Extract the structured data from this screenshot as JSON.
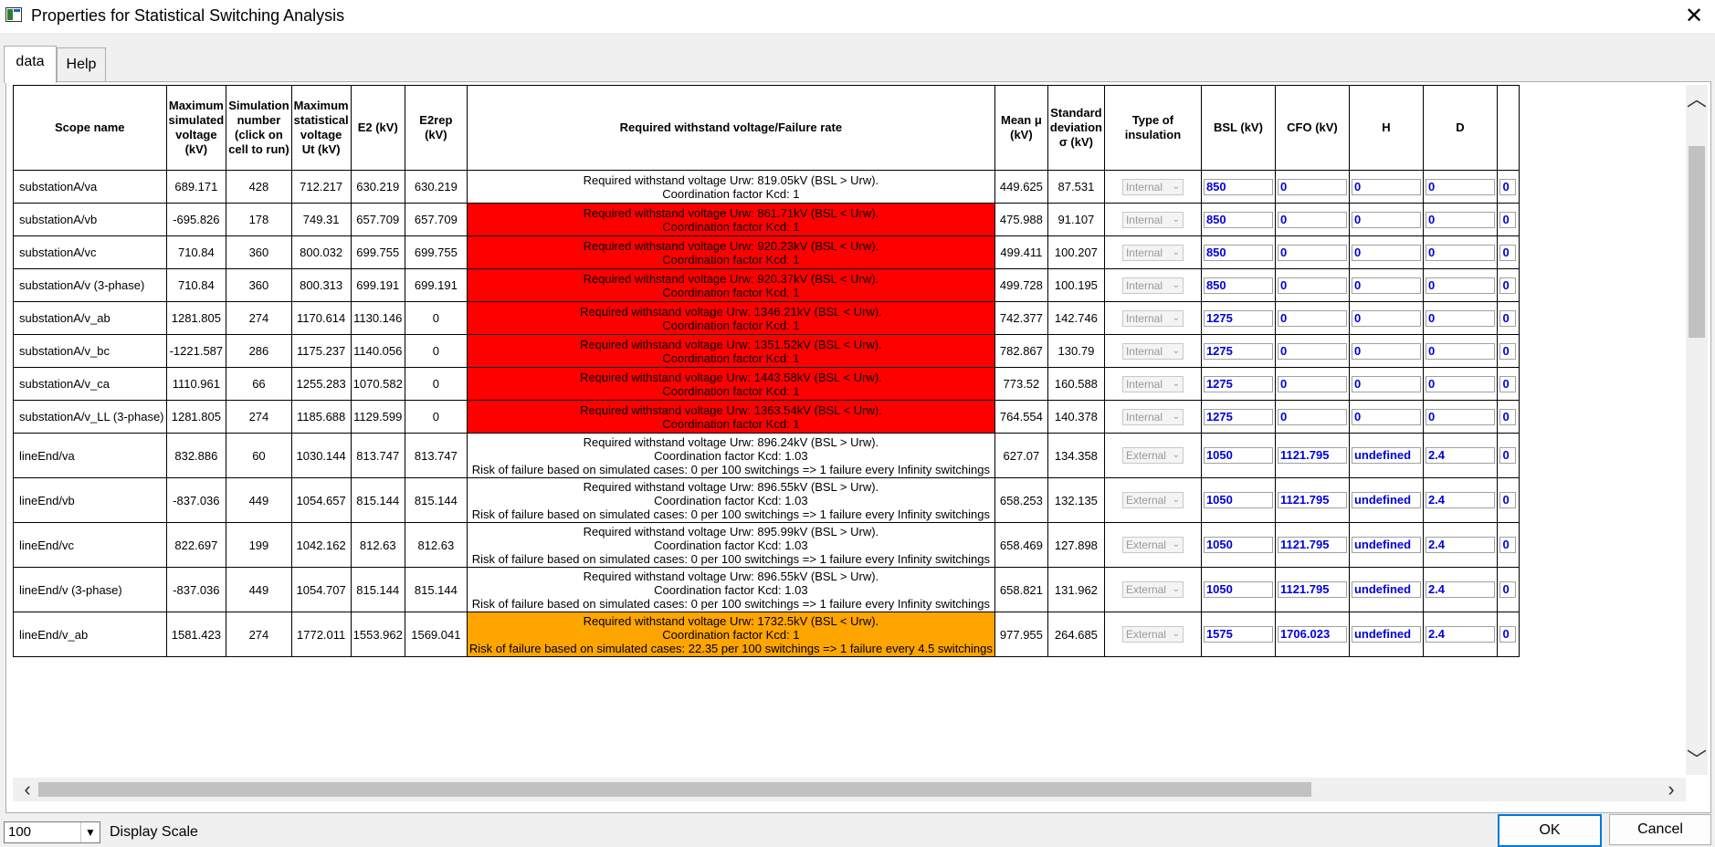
{
  "window": {
    "title": "Properties for Statistical Switching Analysis",
    "close_symbol": "✕"
  },
  "tabs": [
    {
      "label": "data"
    },
    {
      "label": "Help"
    }
  ],
  "grid": {
    "headers": {
      "scope": "Scope name",
      "max_sim": "Maximum simulated voltage (kV)",
      "sim_num": "Simulation number (click on cell to run)",
      "max_stat": "Maximum statistical voltage Ut (kV)",
      "e2": "E2 (kV)",
      "e2rep": "E2rep (kV)",
      "req": "Required withstand voltage/Failure rate",
      "mean": "Mean μ (kV)",
      "std": "Standard deviation σ (kV)",
      "ins": "Type of insulation",
      "bsl": "BSL (kV)",
      "cfo": "CFO (kV)",
      "h": "H",
      "d": "D"
    },
    "rows": [
      {
        "scope": "substationA/va",
        "max_sim": "689.171",
        "sim_num": "428",
        "max_stat": "712.217",
        "e2": "630.219",
        "e2rep": "630.219",
        "req_status": "ok",
        "req_lines": [
          "Required withstand voltage Urw: 819.05kV (BSL > Urw).",
          "Coordination factor Kcd: 1"
        ],
        "mean": "449.625",
        "std": "87.531",
        "ins": "Internal",
        "bsl": "850",
        "cfo": "0",
        "h": "0",
        "d": "0",
        "extra": "0"
      },
      {
        "scope": "substationA/vb",
        "max_sim": "-695.826",
        "sim_num": "178",
        "max_stat": "749.31",
        "e2": "657.709",
        "e2rep": "657.709",
        "req_status": "fail",
        "req_lines": [
          "Required withstand voltage Urw: 861.71kV (BSL < Urw).",
          "Coordination factor Kcd: 1"
        ],
        "mean": "475.988",
        "std": "91.107",
        "ins": "Internal",
        "bsl": "850",
        "cfo": "0",
        "h": "0",
        "d": "0",
        "extra": "0"
      },
      {
        "scope": "substationA/vc",
        "max_sim": "710.84",
        "sim_num": "360",
        "max_stat": "800.032",
        "e2": "699.755",
        "e2rep": "699.755",
        "req_status": "fail",
        "req_lines": [
          "Required withstand voltage Urw: 920.23kV (BSL < Urw).",
          "Coordination factor Kcd: 1"
        ],
        "mean": "499.411",
        "std": "100.207",
        "ins": "Internal",
        "bsl": "850",
        "cfo": "0",
        "h": "0",
        "d": "0",
        "extra": "0"
      },
      {
        "scope": "substationA/v (3-phase)",
        "max_sim": "710.84",
        "sim_num": "360",
        "max_stat": "800.313",
        "e2": "699.191",
        "e2rep": "699.191",
        "req_status": "fail",
        "req_lines": [
          "Required withstand voltage Urw: 920.37kV (BSL < Urw).",
          "Coordination factor Kcd: 1"
        ],
        "mean": "499.728",
        "std": "100.195",
        "ins": "Internal",
        "bsl": "850",
        "cfo": "0",
        "h": "0",
        "d": "0",
        "extra": "0"
      },
      {
        "scope": "substationA/v_ab",
        "max_sim": "1281.805",
        "sim_num": "274",
        "max_stat": "1170.614",
        "e2": "1130.146",
        "e2rep": "0",
        "req_status": "fail",
        "req_lines": [
          "Required withstand voltage Urw: 1346.21kV (BSL < Urw).",
          "Coordination factor Kcd: 1"
        ],
        "mean": "742.377",
        "std": "142.746",
        "ins": "Internal",
        "bsl": "1275",
        "cfo": "0",
        "h": "0",
        "d": "0",
        "extra": "0"
      },
      {
        "scope": "substationA/v_bc",
        "max_sim": "-1221.587",
        "sim_num": "286",
        "max_stat": "1175.237",
        "e2": "1140.056",
        "e2rep": "0",
        "req_status": "fail",
        "req_lines": [
          "Required withstand voltage Urw: 1351.52kV (BSL < Urw).",
          "Coordination factor Kcd: 1"
        ],
        "mean": "782.867",
        "std": "130.79",
        "ins": "Internal",
        "bsl": "1275",
        "cfo": "0",
        "h": "0",
        "d": "0",
        "extra": "0"
      },
      {
        "scope": "substationA/v_ca",
        "max_sim": "1110.961",
        "sim_num": "66",
        "max_stat": "1255.283",
        "e2": "1070.582",
        "e2rep": "0",
        "req_status": "fail",
        "req_lines": [
          "Required withstand voltage Urw: 1443.58kV (BSL < Urw).",
          "Coordination factor Kcd: 1"
        ],
        "mean": "773.52",
        "std": "160.588",
        "ins": "Internal",
        "bsl": "1275",
        "cfo": "0",
        "h": "0",
        "d": "0",
        "extra": "0"
      },
      {
        "scope": "substationA/v_LL (3-phase)",
        "max_sim": "1281.805",
        "sim_num": "274",
        "max_stat": "1185.688",
        "e2": "1129.599",
        "e2rep": "0",
        "req_status": "fail",
        "req_lines": [
          "Required withstand voltage Urw: 1363.54kV (BSL < Urw).",
          "Coordination factor Kcd: 1"
        ],
        "mean": "764.554",
        "std": "140.378",
        "ins": "Internal",
        "bsl": "1275",
        "cfo": "0",
        "h": "0",
        "d": "0",
        "extra": "0"
      },
      {
        "scope": "lineEnd/va",
        "max_sim": "832.886",
        "sim_num": "60",
        "max_stat": "1030.144",
        "e2": "813.747",
        "e2rep": "813.747",
        "req_status": "ok",
        "req_lines": [
          "Required withstand voltage Urw: 896.24kV (BSL > Urw).",
          "Coordination factor Kcd: 1.03",
          "Risk of failure based on simulated cases: 0 per 100 switchings => 1 failure every Infinity switchings"
        ],
        "mean": "627.07",
        "std": "134.358",
        "ins": "External",
        "bsl": "1050",
        "cfo": "1121.795",
        "h": "undefined",
        "d": "2.4",
        "extra": "0"
      },
      {
        "scope": "lineEnd/vb",
        "max_sim": "-837.036",
        "sim_num": "449",
        "max_stat": "1054.657",
        "e2": "815.144",
        "e2rep": "815.144",
        "req_status": "ok",
        "req_lines": [
          "Required withstand voltage Urw: 896.55kV (BSL > Urw).",
          "Coordination factor Kcd: 1.03",
          "Risk of failure based on simulated cases: 0 per 100 switchings => 1 failure every Infinity switchings"
        ],
        "mean": "658.253",
        "std": "132.135",
        "ins": "External",
        "bsl": "1050",
        "cfo": "1121.795",
        "h": "undefined",
        "d": "2.4",
        "extra": "0"
      },
      {
        "scope": "lineEnd/vc",
        "max_sim": "822.697",
        "sim_num": "199",
        "max_stat": "1042.162",
        "e2": "812.63",
        "e2rep": "812.63",
        "req_status": "ok",
        "req_lines": [
          "Required withstand voltage Urw: 895.99kV (BSL > Urw).",
          "Coordination factor Kcd: 1.03",
          "Risk of failure based on simulated cases: 0 per 100 switchings => 1 failure every Infinity switchings"
        ],
        "mean": "658.469",
        "std": "127.898",
        "ins": "External",
        "bsl": "1050",
        "cfo": "1121.795",
        "h": "undefined",
        "d": "2.4",
        "extra": "0"
      },
      {
        "scope": "lineEnd/v (3-phase)",
        "max_sim": "-837.036",
        "sim_num": "449",
        "max_stat": "1054.707",
        "e2": "815.144",
        "e2rep": "815.144",
        "req_status": "ok",
        "req_lines": [
          "Required withstand voltage Urw: 896.55kV (BSL > Urw).",
          "Coordination factor Kcd: 1.03",
          "Risk of failure based on simulated cases: 0 per 100 switchings => 1 failure every Infinity switchings"
        ],
        "mean": "658.821",
        "std": "131.962",
        "ins": "External",
        "bsl": "1050",
        "cfo": "1121.795",
        "h": "undefined",
        "d": "2.4",
        "extra": "0"
      },
      {
        "scope": "lineEnd/v_ab",
        "max_sim": "1581.423",
        "sim_num": "274",
        "max_stat": "1772.011",
        "e2": "1553.962",
        "e2rep": "1569.041",
        "req_status": "warn",
        "req_lines": [
          "Required withstand voltage Urw: 1732.5kV (BSL < Urw).",
          "Coordination factor Kcd: 1",
          "Risk of failure based on simulated cases: 22.35 per 100 switchings => 1 failure every 4.5 switchings"
        ],
        "mean": "977.955",
        "std": "264.685",
        "ins": "External",
        "bsl": "1575",
        "cfo": "1706.023",
        "h": "undefined",
        "d": "2.4",
        "extra": "0"
      }
    ]
  },
  "colors": {
    "fail": "#ff0000",
    "warn": "#ffa500",
    "ok": "#ffffff",
    "input_text": "#0000dd"
  },
  "footer": {
    "scale_value": "100",
    "scale_label": "Display Scale",
    "ok_label": "OK",
    "cancel_label": "Cancel"
  }
}
